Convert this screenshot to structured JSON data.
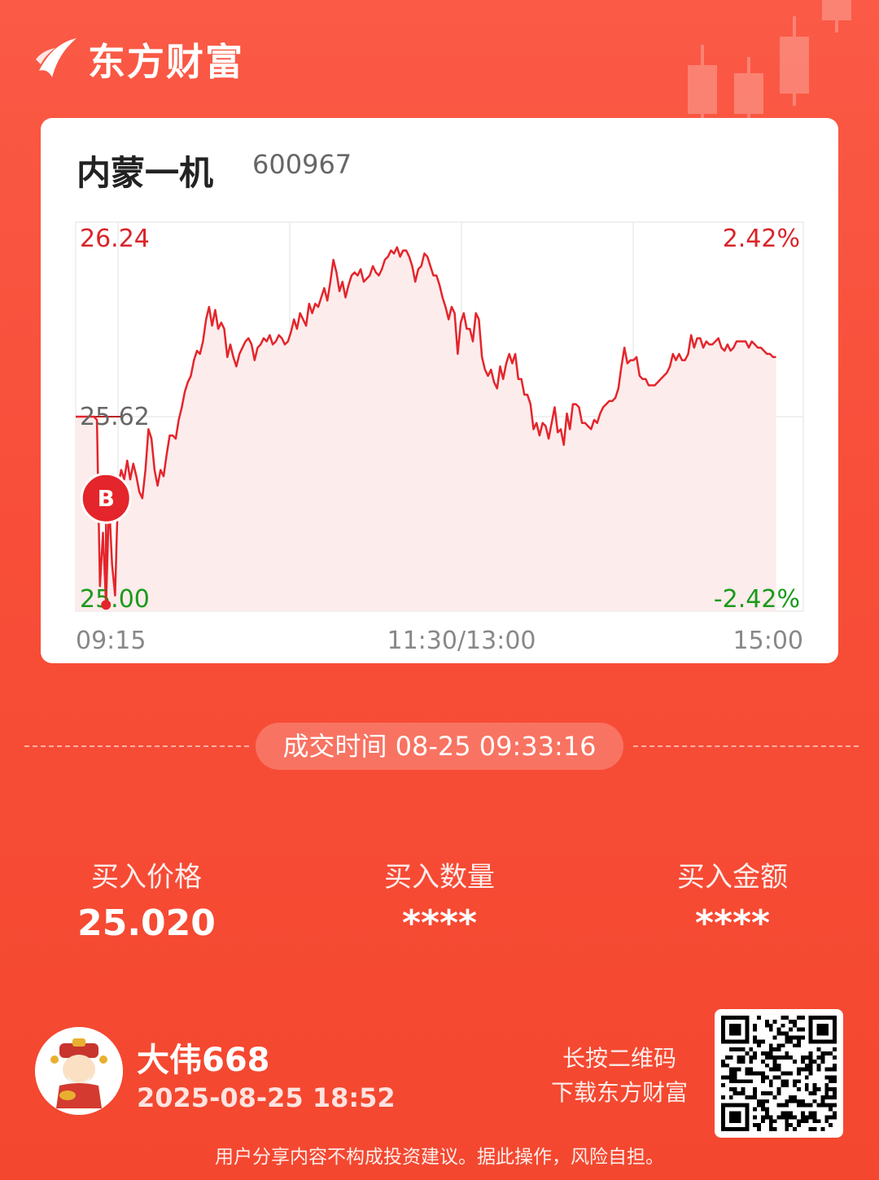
{
  "brand": {
    "name": "东方财富"
  },
  "stock": {
    "name": "内蒙一机",
    "code": "600967"
  },
  "chart_data": {
    "type": "line",
    "y_labels": {
      "top": "26.24",
      "mid": "25.62",
      "bottom": "25.00"
    },
    "pct_labels": {
      "top": "2.42%",
      "bottom": "-2.42%"
    },
    "x_labels": [
      "09:15",
      "11:30/13:00",
      "15:00"
    ],
    "ylim": [
      25.0,
      26.24
    ],
    "prev_close": 25.62,
    "grid": true,
    "colors": {
      "line": "#e4252b",
      "up": "#e4252b",
      "down": "#1a9a1a",
      "fill": "#fdecec"
    },
    "series": [
      {
        "values": [
          25.62,
          25.62,
          25.62,
          25.62,
          25.62,
          25.62,
          25.62,
          25.61,
          25.08,
          25.25,
          25.02,
          25.35,
          25.15,
          25.05,
          25.4,
          25.45,
          25.42,
          25.48,
          25.42,
          25.47,
          25.43,
          25.38,
          25.36,
          25.45,
          25.58,
          25.55,
          25.45,
          25.4,
          25.45,
          25.43,
          25.5,
          25.56,
          25.56,
          25.55,
          25.61,
          25.65,
          25.7,
          25.73,
          25.75,
          25.8,
          25.83,
          25.82,
          25.86,
          25.93,
          25.97,
          25.91,
          25.96,
          25.9,
          25.92,
          25.9,
          25.81,
          25.85,
          25.81,
          25.78,
          25.82,
          25.84,
          25.86,
          25.87,
          25.85,
          25.8,
          25.84,
          25.85,
          25.87,
          25.86,
          25.88,
          25.85,
          25.86,
          25.88,
          25.87,
          25.85,
          25.86,
          25.89,
          25.93,
          25.9,
          25.95,
          25.93,
          25.91,
          25.98,
          25.95,
          25.98,
          25.97,
          26.0,
          26.03,
          25.99,
          26.05,
          26.12,
          26.08,
          26.02,
          26.05,
          26.0,
          26.04,
          26.07,
          26.08,
          26.07,
          26.09,
          26.05,
          26.06,
          26.07,
          26.1,
          26.08,
          26.07,
          26.09,
          26.12,
          26.13,
          26.15,
          26.14,
          26.16,
          26.13,
          26.15,
          26.15,
          26.13,
          26.1,
          26.05,
          26.09,
          26.1,
          26.14,
          26.13,
          26.1,
          26.07,
          26.07,
          26.04,
          26.0,
          25.97,
          25.93,
          25.97,
          25.95,
          25.82,
          25.92,
          25.95,
          25.9,
          25.9,
          25.86,
          25.95,
          25.93,
          25.81,
          25.77,
          25.75,
          25.77,
          25.73,
          25.71,
          25.78,
          25.74,
          25.79,
          25.82,
          25.79,
          25.82,
          25.74,
          25.74,
          25.69,
          25.69,
          25.66,
          25.58,
          25.6,
          25.56,
          25.6,
          25.59,
          25.55,
          25.6,
          25.65,
          25.57,
          25.58,
          25.53,
          25.63,
          25.58,
          25.66,
          25.66,
          25.65,
          25.6,
          25.6,
          25.59,
          25.58,
          25.61,
          25.6,
          25.63,
          25.65,
          25.66,
          25.67,
          25.67,
          25.68,
          25.71,
          25.78,
          25.84,
          25.79,
          25.8,
          25.8,
          25.81,
          25.75,
          25.74,
          25.74,
          25.72,
          25.72,
          25.72,
          25.73,
          25.74,
          25.75,
          25.76,
          25.78,
          25.82,
          25.8,
          25.82,
          25.8,
          25.8,
          25.82,
          25.88,
          25.84,
          25.87,
          25.87,
          25.84,
          25.86,
          25.85,
          25.85,
          25.86,
          25.87,
          25.84,
          25.83,
          25.85,
          25.83,
          25.84,
          25.86,
          25.86,
          25.86,
          25.86,
          25.84,
          25.86,
          25.85,
          25.84,
          25.84,
          25.83,
          25.82,
          25.82,
          25.81,
          25.81
        ]
      }
    ],
    "marker": {
      "label": "B",
      "price": 25.02
    }
  },
  "trade": {
    "time_label": "成交时间 08-25 09:33:16"
  },
  "stats": [
    {
      "label": "买入价格",
      "value": "25.020"
    },
    {
      "label": "买入数量",
      "value": "****"
    },
    {
      "label": "买入金额",
      "value": "****"
    }
  ],
  "user": {
    "name": "大伟668",
    "time": "2025-08-25 18:52"
  },
  "qr_hint": {
    "line1": "长按二维码",
    "line2": "下载东方财富"
  },
  "disclaimer": "用户分享内容不构成投资建议。据此操作，风险自担。"
}
